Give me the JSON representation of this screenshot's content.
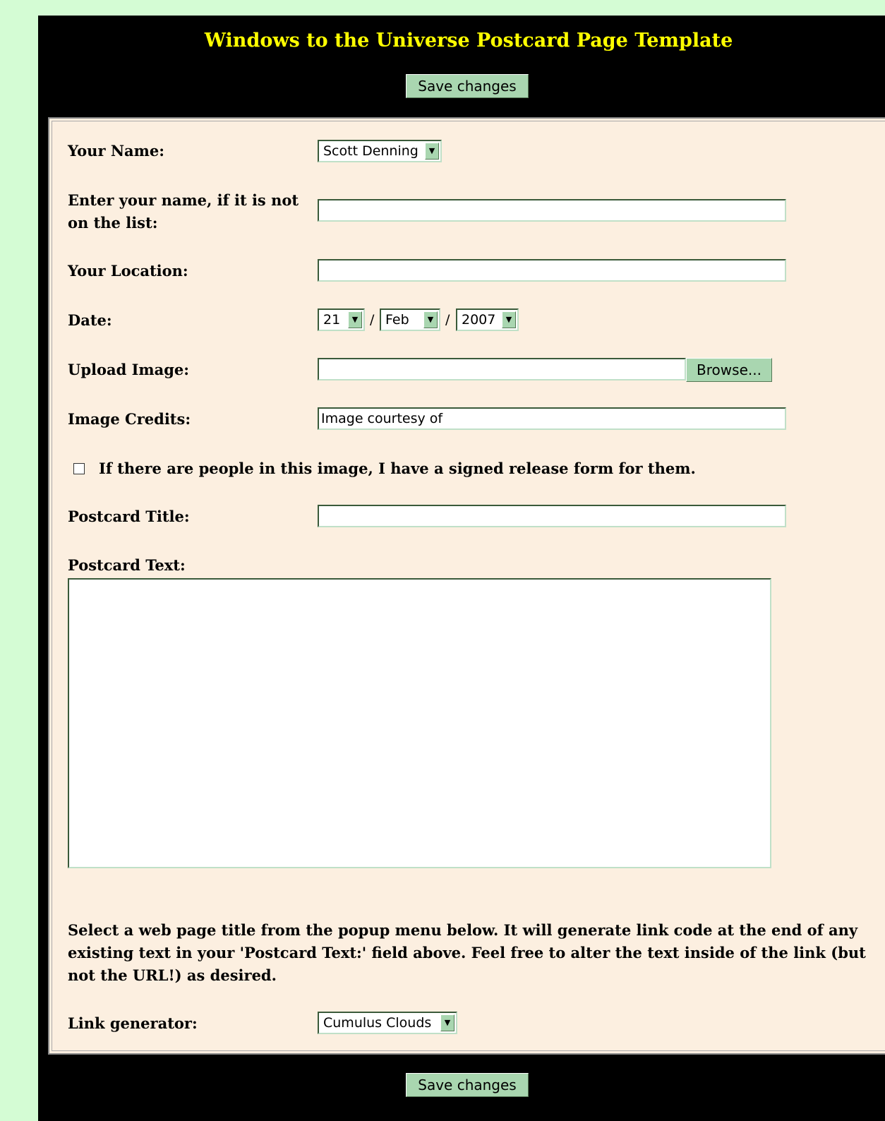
{
  "header": {
    "title": "Windows to the Universe Postcard Page Template",
    "save_label": "Save changes"
  },
  "form": {
    "name_label": "Your Name:",
    "name_selected": "Scott Denning",
    "other_name_label_line1": "Enter your name, if it is not",
    "other_name_label_line2": "on the list:",
    "other_name_value": "",
    "location_label": "Your Location:",
    "location_value": "",
    "date_label": "Date:",
    "date_day": "21",
    "date_month": "Feb",
    "date_year": "2007",
    "date_separator": "/",
    "upload_label": "Upload Image:",
    "upload_value": "",
    "browse_label": "Browse...",
    "credits_label": "Image Credits:",
    "credits_value": "Image courtesy of",
    "release_checked": false,
    "release_label": "If there are people in this image, I have a signed release form for them.",
    "title_label": "Postcard Title:",
    "title_value": "",
    "text_label": "Postcard Text:",
    "text_value": "",
    "link_instructions": "Select a web page title from the popup menu below. It will generate link code at the end of any existing text in your 'Postcard Text:' field above. Feel free to alter the text inside of the link (but not the URL!) as desired.",
    "link_label": "Link generator:",
    "link_selected": "Cumulus Clouds"
  },
  "footer": {
    "save_label": "Save changes"
  },
  "colors": {
    "page_bg": "#d4fcd4",
    "frame_bg": "#000000",
    "title": "#ffff00",
    "panel_bg": "#fcefe0",
    "button_bg": "#a9d6b0"
  },
  "icons": {
    "dropdown_arrow": "chevron-down-icon"
  }
}
